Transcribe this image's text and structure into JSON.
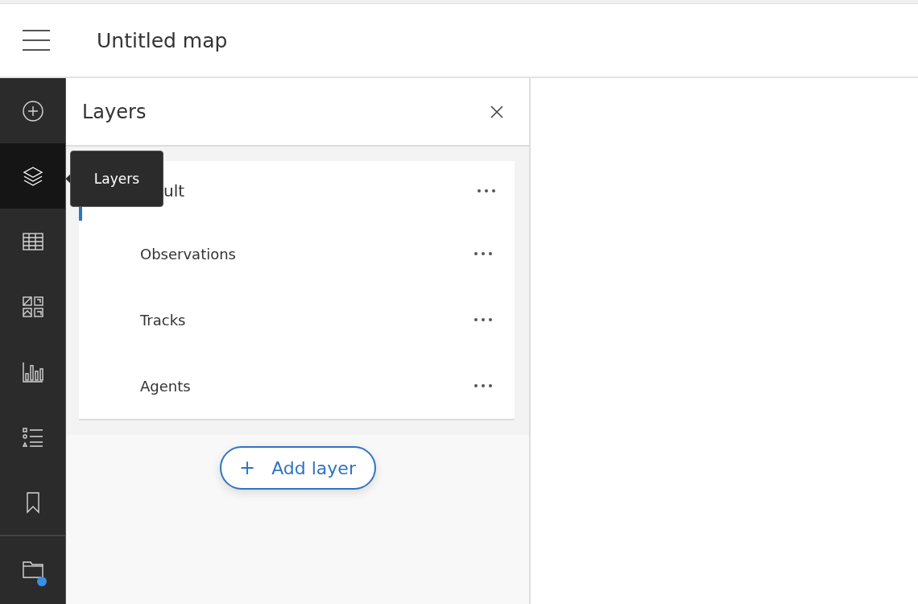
{
  "header": {
    "title": "Untitled map"
  },
  "sidebar": {
    "items": [
      {
        "kind": "add",
        "selected": false
      },
      {
        "kind": "layers",
        "selected": true
      },
      {
        "kind": "table",
        "selected": false
      },
      {
        "kind": "grid",
        "selected": false
      },
      {
        "kind": "chart",
        "selected": false
      },
      {
        "kind": "legend",
        "selected": false
      },
      {
        "kind": "bookmark",
        "selected": false
      },
      {
        "kind": "folder",
        "selected": false,
        "notification": true
      }
    ]
  },
  "tooltip": {
    "text": "Layers"
  },
  "panel": {
    "title": "Layers",
    "group": {
      "label": "ult",
      "children": [
        {
          "label": "Observations"
        },
        {
          "label": "Tracks"
        },
        {
          "label": "Agents"
        }
      ]
    },
    "add_button": {
      "icon": "+",
      "label": "Add layer"
    }
  }
}
